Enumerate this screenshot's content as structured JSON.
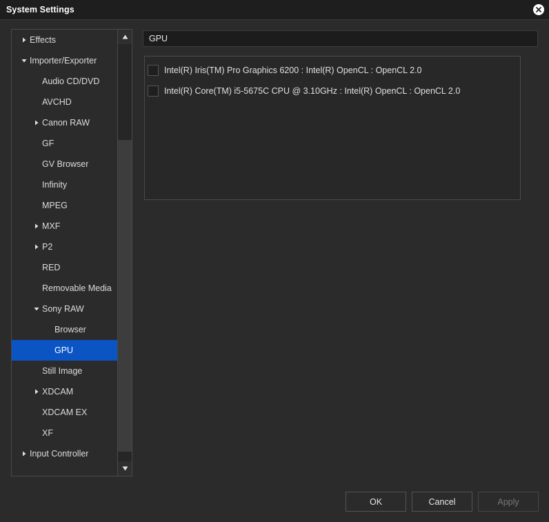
{
  "window": {
    "title": "System Settings",
    "close_icon": "close-icon",
    "accent_color": "#0a54c4",
    "background_color": "#2b2b2b",
    "titlebar_color": "#1e1e1e"
  },
  "tree": {
    "scrollbar": {
      "up_icon": "triangle-up-icon",
      "down_icon": "triangle-down-icon"
    },
    "items": [
      {
        "label": "Effects",
        "level": 0,
        "twisty": "collapsed",
        "selected": false
      },
      {
        "label": "Importer/Exporter",
        "level": 0,
        "twisty": "expanded",
        "selected": false
      },
      {
        "label": "Audio CD/DVD",
        "level": 1,
        "twisty": "none",
        "selected": false
      },
      {
        "label": "AVCHD",
        "level": 1,
        "twisty": "none",
        "selected": false
      },
      {
        "label": "Canon RAW",
        "level": 1,
        "twisty": "collapsed",
        "selected": false
      },
      {
        "label": "GF",
        "level": 1,
        "twisty": "none",
        "selected": false
      },
      {
        "label": "GV Browser",
        "level": 1,
        "twisty": "none",
        "selected": false
      },
      {
        "label": "Infinity",
        "level": 1,
        "twisty": "none",
        "selected": false
      },
      {
        "label": "MPEG",
        "level": 1,
        "twisty": "none",
        "selected": false
      },
      {
        "label": "MXF",
        "level": 1,
        "twisty": "collapsed",
        "selected": false
      },
      {
        "label": "P2",
        "level": 1,
        "twisty": "collapsed",
        "selected": false
      },
      {
        "label": "RED",
        "level": 1,
        "twisty": "none",
        "selected": false
      },
      {
        "label": "Removable Media",
        "level": 1,
        "twisty": "none",
        "selected": false
      },
      {
        "label": "Sony RAW",
        "level": 1,
        "twisty": "expanded",
        "selected": false
      },
      {
        "label": "Browser",
        "level": 2,
        "twisty": "none",
        "selected": false
      },
      {
        "label": "GPU",
        "level": 2,
        "twisty": "none",
        "selected": true
      },
      {
        "label": "Still Image",
        "level": 1,
        "twisty": "none",
        "selected": false
      },
      {
        "label": "XDCAM",
        "level": 1,
        "twisty": "collapsed",
        "selected": false
      },
      {
        "label": "XDCAM EX",
        "level": 1,
        "twisty": "none",
        "selected": false
      },
      {
        "label": "XF",
        "level": 1,
        "twisty": "none",
        "selected": false
      },
      {
        "label": "Input Controller",
        "level": 0,
        "twisty": "collapsed",
        "selected": false
      }
    ]
  },
  "content": {
    "header": "GPU",
    "devices": [
      {
        "label": "Intel(R) Iris(TM) Pro Graphics 6200 : Intel(R) OpenCL : OpenCL 2.0",
        "checked": false
      },
      {
        "label": "Intel(R) Core(TM) i5-5675C CPU @ 3.10GHz : Intel(R) OpenCL : OpenCL 2.0",
        "checked": false
      }
    ]
  },
  "footer": {
    "ok_label": "OK",
    "cancel_label": "Cancel",
    "apply_label": "Apply",
    "apply_disabled": true
  }
}
